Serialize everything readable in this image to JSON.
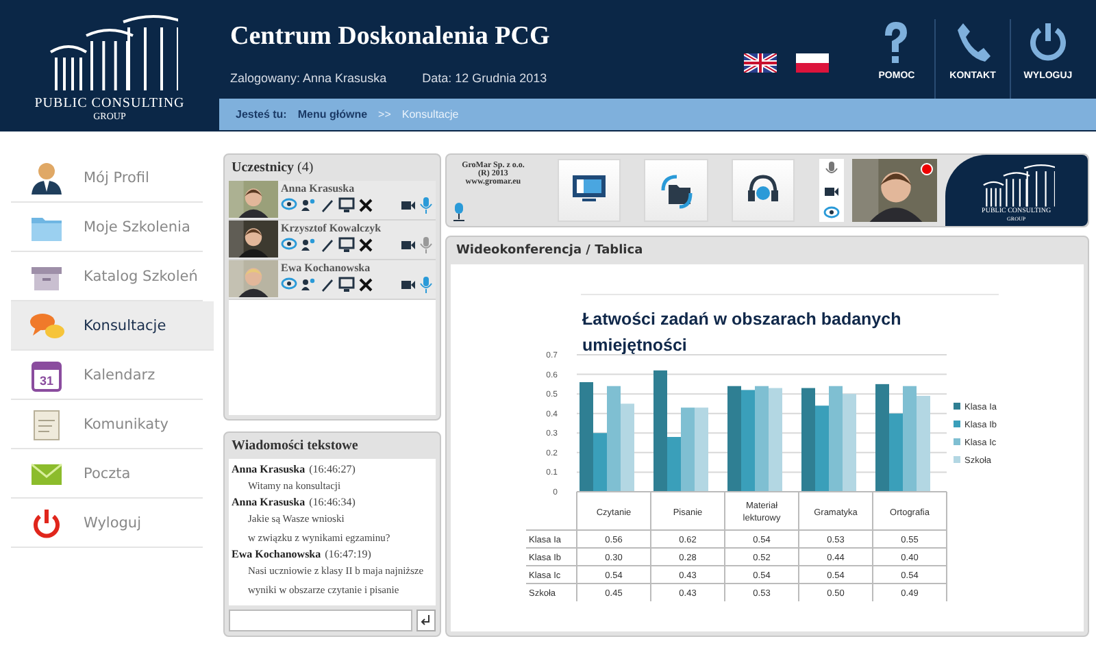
{
  "header": {
    "logo": {
      "line1": "PUBLIC CONSULTING",
      "line2": "GROUP"
    },
    "title": "Centrum Doskonalenia PCG",
    "user_label": "Zalogowany:",
    "user": "Anna Krasuska",
    "date_label": "Data:",
    "date": "12 Grudnia 2013",
    "languages": [
      {
        "kind": "uk"
      },
      {
        "kind": "pl"
      }
    ],
    "nav": [
      {
        "kind": "help",
        "label": "POMOC"
      },
      {
        "kind": "phone",
        "label": "KONTAKT"
      },
      {
        "kind": "power",
        "label": "WYLOGUJ"
      }
    ]
  },
  "breadcrumb": {
    "label": "Jesteś tu:",
    "separator": ">>",
    "items": [
      {
        "text": "Menu główne",
        "current": false
      },
      {
        "text": "Konsultacje",
        "current": true
      }
    ]
  },
  "sidebar": {
    "items": [
      {
        "kind": "profile",
        "label": "Mój Profil",
        "selected": false
      },
      {
        "kind": "folder",
        "label": "Moje Szkolenia",
        "selected": false
      },
      {
        "kind": "box",
        "label": "Katalog Szkoleń",
        "selected": false
      },
      {
        "kind": "chat",
        "label": "Konsultacje",
        "selected": true
      },
      {
        "kind": "calendar",
        "label": "Kalendarz",
        "icon_text": "31",
        "selected": false
      },
      {
        "kind": "note",
        "label": "Komunikaty",
        "selected": false
      },
      {
        "kind": "mail",
        "label": "Poczta",
        "selected": false
      },
      {
        "kind": "power",
        "label": "Wyloguj",
        "selected": false
      }
    ]
  },
  "participants": {
    "title": "**Uczestnicy** (4)",
    "items": [
      {
        "name": "Anna Krasuska",
        "mic_on": true
      },
      {
        "name": "Krzysztof Kowalczyk",
        "mic_on": false
      },
      {
        "name": "Ewa Kochanowska",
        "mic_on": true
      }
    ]
  },
  "messages": {
    "title": "Wiadomości tekstowe",
    "items": [
      {
        "author": "Anna Krasuska",
        "time": "(16:46:27)",
        "lines": [
          "Witamy na konsultacji"
        ]
      },
      {
        "author": "Anna Krasuska",
        "time": "(16:46:34)",
        "lines": [
          "Jakie są Wasze wnioski",
          "w związku z wynikami egzaminu?"
        ]
      },
      {
        "author": "Ewa Kochanowska",
        "time": "(16:47:19)",
        "lines": [
          "Nasi uczniowie z klasy II b maja najniższe",
          "wyniki w obszarze czytanie i pisanie"
        ]
      }
    ]
  },
  "toolbar": {
    "vendor": [
      "GroMar Sp. z o.o.",
      "(R) 2013",
      "www.gromar.eu"
    ],
    "tools": [
      {
        "kind": "screen"
      },
      {
        "kind": "files"
      },
      {
        "kind": "help"
      }
    ],
    "recording": true,
    "logo": {
      "line1": "PUBLIC CONSULTING",
      "line2": "GROUP"
    }
  },
  "whiteboard": {
    "title": "Wideokonferencja / Tablica",
    "chart_data": {
      "type": "bar",
      "title": "Łatwości zadań w obszarach badanych umiejętności",
      "categories": [
        "Czytanie",
        "Pisanie",
        "Materiał lekturowy",
        "Gramatyka",
        "Ortografia"
      ],
      "ylim": [
        0,
        0.7
      ],
      "yticks": [
        0,
        0.1,
        0.2,
        0.3,
        0.4,
        0.5,
        0.6,
        0.7
      ],
      "grid": true,
      "legend": true,
      "value_labels": [
        [
          "0.56",
          "0.62",
          "0.54",
          "0.53",
          "0.55"
        ],
        [
          "0.30",
          "0.28",
          "0.52",
          "0.44",
          "0.40"
        ],
        [
          "0.54",
          "0.43",
          "0.54",
          "0.54",
          "0.54"
        ],
        [
          "0.45",
          "0.43",
          "0.53",
          "0.50",
          "0.49"
        ]
      ],
      "series": [
        {
          "name": "Klasa Ia",
          "color": "#2f7f93",
          "values": [
            0.56,
            0.62,
            0.54,
            0.53,
            0.55
          ]
        },
        {
          "name": "Klasa Ib",
          "color": "#3a9fba",
          "values": [
            0.3,
            0.28,
            0.52,
            0.44,
            0.4
          ]
        },
        {
          "name": "Klasa Ic",
          "color": "#7fbfd2",
          "values": [
            0.54,
            0.43,
            0.54,
            0.54,
            0.54
          ]
        },
        {
          "name": "Szkoła",
          "color": "#b3d7e3",
          "values": [
            0.45,
            0.43,
            0.53,
            0.5,
            0.49
          ]
        }
      ]
    }
  }
}
